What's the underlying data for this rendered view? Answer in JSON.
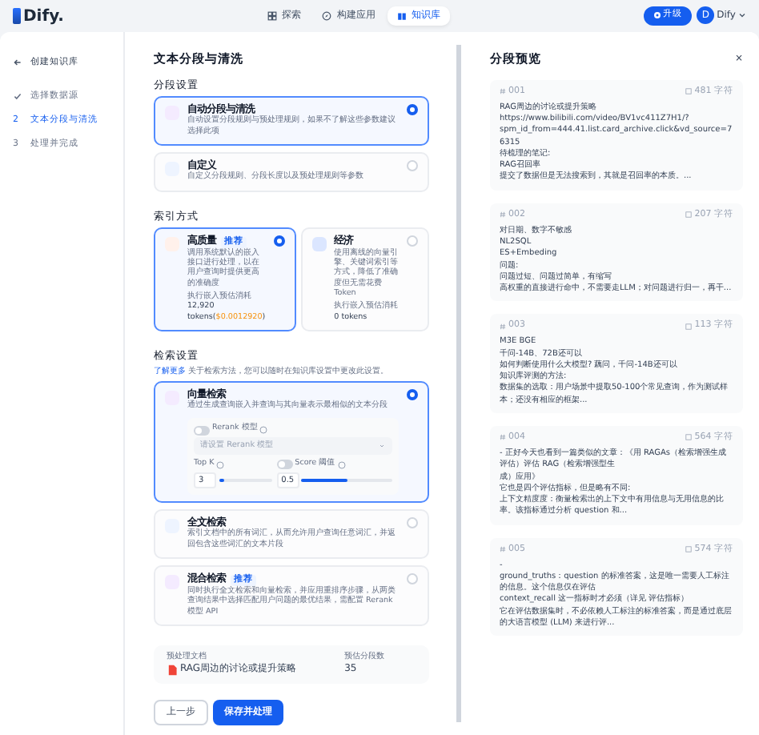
{
  "header": {
    "logo": "Dify.",
    "nav": [
      {
        "label": "探索",
        "selected": false
      },
      {
        "label": "构建应用",
        "selected": false
      },
      {
        "label": "知识库",
        "selected": true
      }
    ],
    "upgrade": "升级",
    "avatar": "D",
    "user": "Dify"
  },
  "sidebar": {
    "back": "创建知识库",
    "steps": [
      {
        "label": "选择数据源",
        "completed": true,
        "selected": false
      },
      {
        "number": "2",
        "label": "文本分段与清洗",
        "completed": false,
        "selected": true
      },
      {
        "number": "3",
        "label": "处理并完成",
        "completed": false,
        "selected": false
      }
    ]
  },
  "main": {
    "title": "文本分段与清洗",
    "segment_heading": "分段设置",
    "segment_options": [
      {
        "title": "自动分段与清洗",
        "desc": "自动设置分段规则与预处理规则，如果不了解这些参数建议选择此项",
        "selected": true
      },
      {
        "title": "自定义",
        "desc": "自定义分段规则、分段长度以及预处理规则等参数",
        "selected": false
      }
    ],
    "index_heading": "索引方式",
    "index_options": [
      {
        "title": "高质量",
        "badge": "推荐",
        "desc": "调用系统默认的嵌入接口进行处理，以在用户查询时提供更高的准确度",
        "cost_label": "执行嵌入预估消耗",
        "cost": "12,920",
        "cost_unit": "tokens(",
        "price": "$0.0012920",
        "cost_end": ")",
        "selected": true
      },
      {
        "title": "经济",
        "desc": "使用离线的向量引擎、关键词索引等方式，降低了准确度但无需花费 Token",
        "cost_label": "执行嵌入预估消耗",
        "cost": "0 tokens",
        "selected": false
      }
    ],
    "retrieval_heading": "检索设置",
    "retrieval_link": "了解更多",
    "retrieval_note": "关于检索方法，您可以随时在知识库设置中更改此设置。",
    "retrieval_options": [
      {
        "title": "向量检索",
        "desc": "通过生成查询嵌入并查询与其向量表示最相似的文本分段",
        "selected": true,
        "settings": {
          "rerank_label": "Rerank 模型",
          "rerank_on": false,
          "rerank_placeholder": "请设置 Rerank 模型",
          "topk": {
            "label": "Top K",
            "value": "3",
            "level": 0.1
          },
          "score": {
            "label": "Score 阈值",
            "on": false,
            "value": "0.5",
            "level": 0.5
          }
        }
      },
      {
        "title": "全文检索",
        "desc": "索引文档中的所有词汇，从而允许用户查询任意词汇，并返回包含这些词汇的文本片段",
        "selected": false
      },
      {
        "title": "混合检索",
        "badge": "推荐",
        "desc": "同时执行全文检索和向量检索，并应用重排序步骤，从两类查询结果中选择匹配用户问题的最优结果，需配置 Rerank 模型 API",
        "selected": false
      }
    ],
    "document": {
      "doc_label": "预处理文档",
      "doc_name": "RAG周边的讨论或提升策略",
      "count_label": "预估分段数",
      "count": "35"
    },
    "buttons": [
      {
        "label": "上一步",
        "kind": "secondary"
      },
      {
        "label": "保存并处理",
        "kind": "primary"
      }
    ]
  },
  "preview": {
    "title": "分段预览",
    "close": "×",
    "segments": [
      {
        "id": "001",
        "chars": "481 字符",
        "lines": [
          "RAG周边的讨论或提升策略",
          "https://www.bilibili.com/video/BV1vc411Z7H1/?",
          "spm_id_from=444.41.list.card_archive.click&vd_source=76315",
          "待梳理的笔记:",
          "RAG召回率",
          "提交了数据但是无法搜索到，其就是召回率的本质。..."
        ]
      },
      {
        "id": "002",
        "chars": "207 字符",
        "lines": [
          "对日期、数字不敏感",
          "NL2SQL",
          "ES+Embeding",
          "问题:",
          "问题过短、问题过简单，有缩写",
          "高权重的直接进行命中，不需要走LLM；对问题进行归一，再干..."
        ]
      },
      {
        "id": "003",
        "chars": "113 字符",
        "lines": [
          "M3E BGE",
          "千问-14B、72B还可以",
          "如何判断使用什么大模型? 藕问，千问-14B还可以",
          "知识库评测的方法:",
          "数据集的选取：用户场景中提取50-100个常见查询，作为测试样本；还没有相应的框架..."
        ]
      },
      {
        "id": "004",
        "chars": "564 字符",
        "lines": [
          "- 正好今天也看到一篇类似的文章：《用 RAGAs（检索增强生成评估）评估 RAG（检索增强型生",
          "成）应用》",
          "它也是四个评估指标，但是略有不同:",
          "上下文精度度：衡量检索出的上下文中有用信息与无用信息的比率。该指标通过分析 question 和..."
        ]
      },
      {
        "id": "005",
        "chars": "574 字符",
        "lines": [
          "-",
          "ground_truths：question 的标准答案，这是唯一需要人工标注的信息。这个信息仅在评估",
          "context_recall 这一指标时才必须（详见 评估指标）",
          "它在评估数据集时，不必依赖人工标注的标准答案，而是通过底层的大语言模型 (LLM) 来进行评..."
        ]
      }
    ]
  }
}
